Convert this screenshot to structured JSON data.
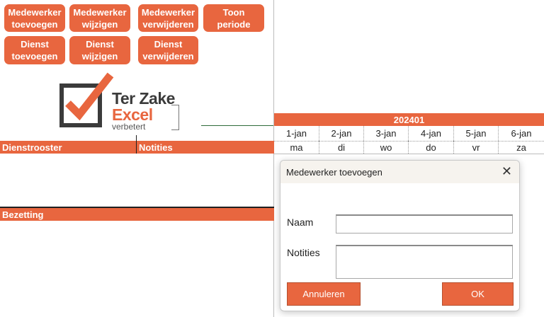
{
  "buttons": {
    "medewerker_toevoegen": "Medewerker\ntoevoegen",
    "medewerker_wijzigen": "Medewerker\nwijzigen",
    "medewerker_verwijderen": "Medewerker\nverwijderen",
    "toon_periode": "Toon periode",
    "dienst_toevoegen": "Dienst\ntoevoegen",
    "dienst_wijzigen": "Dienst\nwijzigen",
    "dienst_verwijderen": "Dienst\nverwijderen"
  },
  "logo": {
    "line1": "Ter Zake",
    "line2": "Excel",
    "line3": "verbetert"
  },
  "sections": {
    "dienstrooster": "Dienstrooster",
    "notities": "Notities",
    "bezetting": "Bezetting"
  },
  "calendar": {
    "period": "202401",
    "dates": [
      "1-jan",
      "2-jan",
      "3-jan",
      "4-jan",
      "5-jan",
      "6-jan"
    ],
    "days": [
      "ma",
      "di",
      "wo",
      "do",
      "vr",
      "za"
    ]
  },
  "dialog": {
    "title": "Medewerker toevoegen",
    "close": "✕",
    "naam_label": "Naam",
    "notities_label": "Notities",
    "naam_value": "",
    "notities_value": "",
    "cancel": "Annuleren",
    "ok": "OK"
  },
  "colors": {
    "accent": "#e8663f",
    "logo_dark": "#3b3b3b"
  }
}
